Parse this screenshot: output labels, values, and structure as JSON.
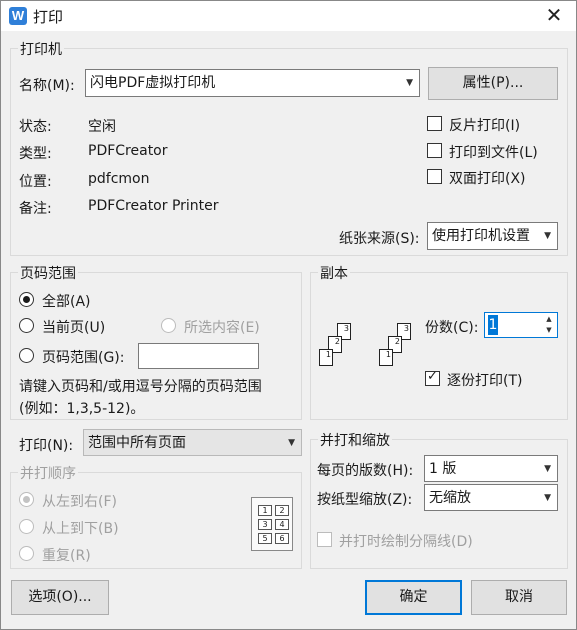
{
  "window": {
    "title": "打印",
    "app_icon": "W"
  },
  "printer": {
    "group_label": "打印机",
    "name_label": "名称(M):",
    "name_value": "闪电PDF虚拟打印机",
    "properties_button": "属性(P)...",
    "status_label": "状态:",
    "status_value": "空闲",
    "type_label": "类型:",
    "type_value": "PDFCreator",
    "location_label": "位置:",
    "location_value": "pdfcmon",
    "comment_label": "备注:",
    "comment_value": "PDFCreator Printer",
    "reverse_print": "反片打印(I)",
    "print_to_file": "打印到文件(L)",
    "duplex": "双面打印(X)",
    "paper_source_label": "纸张来源(S):",
    "paper_source_value": "使用打印机设置"
  },
  "page_range": {
    "group_label": "页码范围",
    "all": "全部(A)",
    "current": "当前页(U)",
    "selection": "所选内容(E)",
    "pages": "页码范围(G):",
    "hint_line1": "请键入页码和/或用逗号分隔的页码范围",
    "hint_line2": "(例如：1,3,5-12)。"
  },
  "copies": {
    "group_label": "副本",
    "count_label": "份数(C):",
    "count_value": "1",
    "collate": "逐份打印(T)",
    "page_numbers": [
      "3",
      "2",
      "1",
      "3",
      "2",
      "1"
    ]
  },
  "print_what": {
    "label": "打印(N):",
    "value": "范围中所有页面"
  },
  "print_order": {
    "group_label": "并打顺序",
    "left_to_right": "从左到右(F)",
    "top_to_bottom": "从上到下(B)",
    "repeat": "重复(R)",
    "cells": [
      "1",
      "2",
      "3",
      "4",
      "5",
      "6"
    ]
  },
  "zoom": {
    "group_label": "并打和缩放",
    "pages_per_sheet_label": "每页的版数(H):",
    "pages_per_sheet_value": "1 版",
    "scale_label": "按纸型缩放(Z):",
    "scale_value": "无缩放",
    "draw_borders": "并打时绘制分隔线(D)"
  },
  "footer": {
    "options": "选项(O)...",
    "ok": "确定",
    "cancel": "取消"
  }
}
